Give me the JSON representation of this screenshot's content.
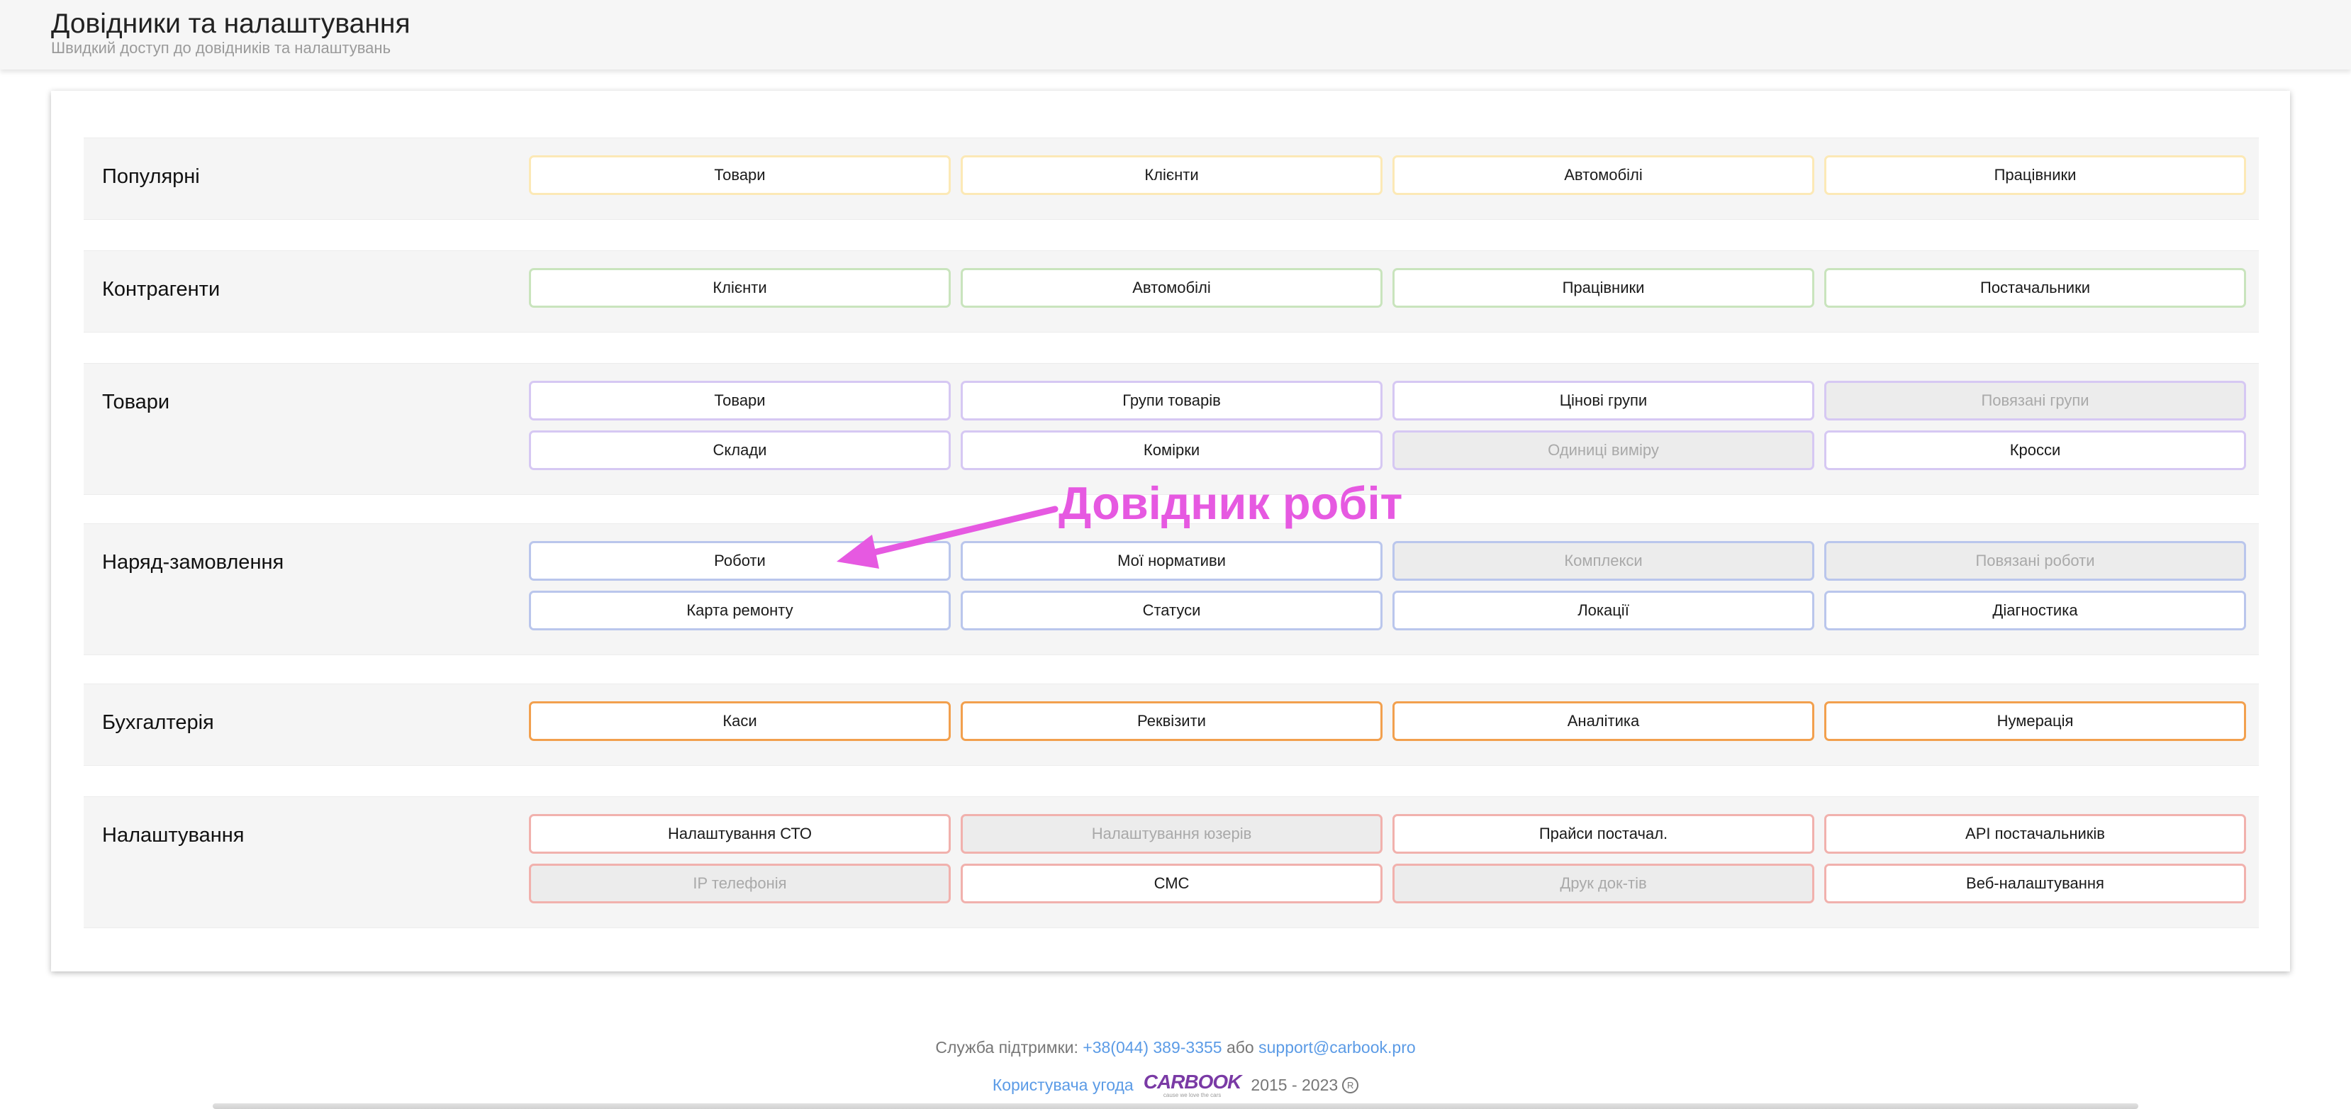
{
  "header": {
    "title": "Довідники та налаштування",
    "subtitle": "Швидкий доступ до довідників та налаштувань"
  },
  "sections": [
    {
      "label": "Популярні",
      "color": "#fce9b6",
      "buttons": [
        {
          "label": "Товари",
          "disabled": false
        },
        {
          "label": "Клієнти",
          "disabled": false
        },
        {
          "label": "Автомобілі",
          "disabled": false
        },
        {
          "label": "Працівники",
          "disabled": false
        }
      ]
    },
    {
      "label": "Контрагенти",
      "color": "#c9e4bd",
      "buttons": [
        {
          "label": "Клієнти",
          "disabled": false
        },
        {
          "label": "Автомобілі",
          "disabled": false
        },
        {
          "label": "Працівники",
          "disabled": false
        },
        {
          "label": "Постачальники",
          "disabled": false
        }
      ]
    },
    {
      "label": "Товари",
      "color": "#d6c8f3",
      "buttons": [
        {
          "label": "Товари",
          "disabled": false
        },
        {
          "label": "Групи товарів",
          "disabled": false
        },
        {
          "label": "Цінові групи",
          "disabled": false
        },
        {
          "label": "Повязані групи",
          "disabled": true
        },
        {
          "label": "Склади",
          "disabled": false
        },
        {
          "label": "Комірки",
          "disabled": false
        },
        {
          "label": "Одиниці виміру",
          "disabled": true
        },
        {
          "label": "Кросси",
          "disabled": false
        }
      ]
    },
    {
      "label": "Наряд-замовлення",
      "color": "#bac6ec",
      "buttons": [
        {
          "label": "Роботи",
          "disabled": false
        },
        {
          "label": "Мої нормативи",
          "disabled": false
        },
        {
          "label": "Комплекси",
          "disabled": true
        },
        {
          "label": "Повязані роботи",
          "disabled": true
        },
        {
          "label": "Карта ремонту",
          "disabled": false
        },
        {
          "label": "Статуси",
          "disabled": false
        },
        {
          "label": "Локації",
          "disabled": false
        },
        {
          "label": "Діагностика",
          "disabled": false
        }
      ]
    },
    {
      "label": "Бухгалтерія",
      "color": "#f2a04e",
      "buttons": [
        {
          "label": "Каси",
          "disabled": false
        },
        {
          "label": "Реквізити",
          "disabled": false
        },
        {
          "label": "Аналітика",
          "disabled": false
        },
        {
          "label": "Нумерація",
          "disabled": false
        }
      ]
    },
    {
      "label": "Налаштування",
      "color": "#f1b1ad",
      "buttons": [
        {
          "label": "Налаштування СТО",
          "disabled": false
        },
        {
          "label": "Налаштування юзерів",
          "disabled": true
        },
        {
          "label": "Прайси постачал.",
          "disabled": false
        },
        {
          "label": "API постачальників",
          "disabled": false
        },
        {
          "label": "IP телефонія",
          "disabled": true
        },
        {
          "label": "СМС",
          "disabled": false
        },
        {
          "label": "Друк док-тів",
          "disabled": true
        },
        {
          "label": "Веб-налаштування",
          "disabled": false
        }
      ]
    }
  ],
  "annotation": {
    "text": "Довідник робіт",
    "color": "#e659e1"
  },
  "footer": {
    "support_label": "Служба підтримки:",
    "phone": "+38(044) 389-3355",
    "or_text": "або",
    "email": "support@carbook.pro",
    "agreement": "Користувача угода",
    "logo_text": "CARBOOK",
    "logo_tagline": "cause we love the cars",
    "years": "2015 - 2023",
    "reg_mark": "R"
  }
}
